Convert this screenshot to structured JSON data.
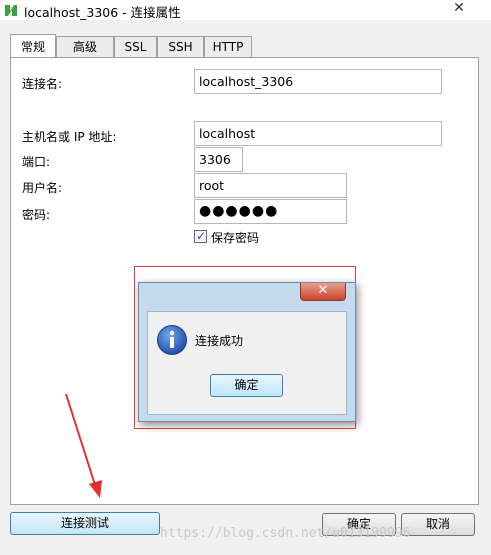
{
  "window": {
    "title": "localhost_3306 - 连接属性",
    "close_glyph": "✕"
  },
  "tabs": [
    {
      "label": "常规",
      "active": true
    },
    {
      "label": "高级",
      "active": false
    },
    {
      "label": "SSL",
      "active": false
    },
    {
      "label": "SSH",
      "active": false
    },
    {
      "label": "HTTP",
      "active": false
    }
  ],
  "form": {
    "connection_name": {
      "label": "连接名:",
      "value": "localhost_3306"
    },
    "host": {
      "label": "主机名或 IP 地址:",
      "value": "localhost"
    },
    "port": {
      "label": "端口:",
      "value": "3306"
    },
    "username": {
      "label": "用户名:",
      "value": "root"
    },
    "password": {
      "label": "密码:",
      "value": "●●●●●●"
    },
    "save_password": {
      "label": "保存密码",
      "checked": true,
      "mark": "✓"
    }
  },
  "dialog": {
    "close_glyph": "✕",
    "message": "连接成功",
    "ok_label": "确定"
  },
  "footer": {
    "test_button": "连接测试",
    "ok_button": "确定",
    "cancel_button": "取消"
  },
  "watermark": "https://blog.csdn.net/u013199996",
  "colors": {
    "annotation_red": "#e04040",
    "dialog_frame": "#c6daee",
    "button_accent": "#3c7fb1"
  }
}
